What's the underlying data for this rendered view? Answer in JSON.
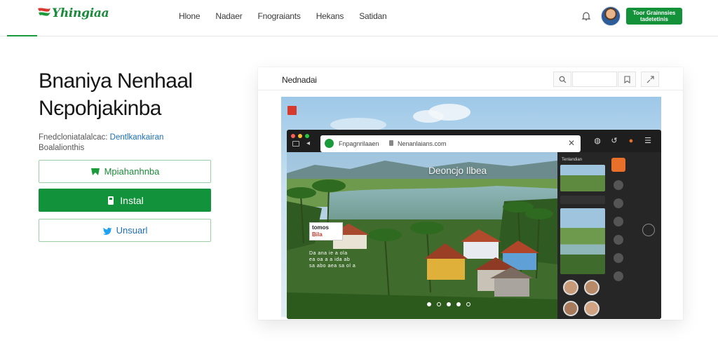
{
  "header": {
    "logo_text": "Yhingiaa",
    "nav_links": [
      "Hlone",
      "Nadaer",
      "Fnograiants",
      "Hekans",
      "Satidan"
    ],
    "cta_label": "Toor Grainnsies tadetetinis"
  },
  "hero": {
    "title_line1": "Bnaniya Nenhaal",
    "title_line2": "Nєpohjakinba",
    "subtitle_plain": "Fnedcloniatalalcac: ",
    "subtitle_link": "Dentlkankairan",
    "subtitle_line2": "Boalalionthis",
    "btn_primary_outline": "Mpiahanhnba",
    "btn_install": "Instal",
    "btn_secondary_outline": "Unsuarl"
  },
  "preview": {
    "panel_title": "Nednadai",
    "browser": {
      "tab_text": "Fnpagnrilaaen",
      "url": "Nenanlaians.com",
      "close_glyph": "✕"
    },
    "scene_caption": "Deoncjo Ilbea",
    "scene_tag_line1": "tomos",
    "scene_tag_line2": "Bila",
    "scene_text": "Da ana ie a ola\nea oa a a ida ab\nsa abo aea sa ol a",
    "sidebar_thumb_label": "Tenlandian"
  },
  "colors": {
    "brand_green": "#13923a",
    "link_blue": "#1a6fb5",
    "accent_orange": "#e8702a"
  }
}
